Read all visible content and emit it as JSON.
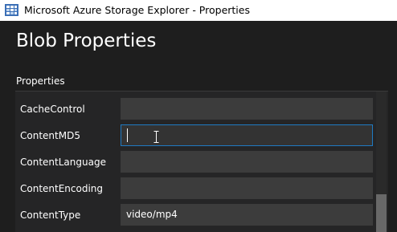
{
  "window": {
    "title": "Microsoft Azure Storage Explorer - Properties",
    "app_icon": "azure-storage-explorer-icon"
  },
  "page": {
    "title": "Blob Properties",
    "section_label": "Properties"
  },
  "properties": [
    {
      "label": "CacheControl",
      "value": ""
    },
    {
      "label": "ContentMD5",
      "value": "",
      "focused": true
    },
    {
      "label": "ContentLanguage",
      "value": ""
    },
    {
      "label": "ContentEncoding",
      "value": ""
    },
    {
      "label": "ContentType",
      "value": "video/mp4"
    }
  ],
  "colors": {
    "background": "#1e1e1e",
    "field": "#3c3c3c",
    "focus_border": "#1f7ac2"
  }
}
